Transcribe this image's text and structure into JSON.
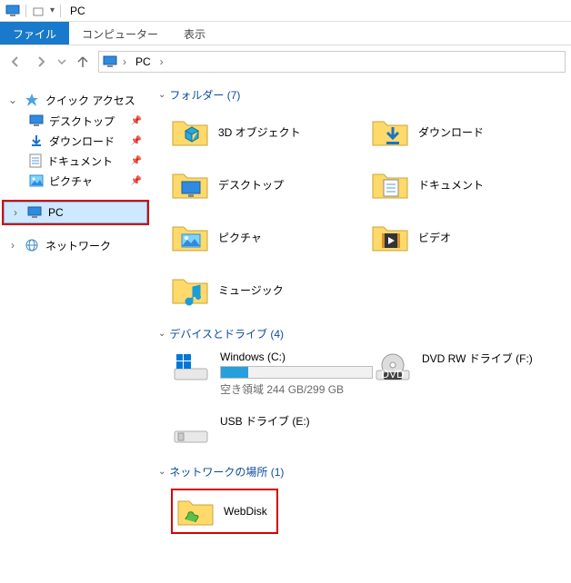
{
  "titlebar": {
    "title": "PC"
  },
  "ribbon": {
    "file": "ファイル",
    "computer": "コンピューター",
    "view": "表示"
  },
  "breadcrumb": {
    "root": "PC"
  },
  "sidebar": {
    "quick_access": "クイック アクセス",
    "items": [
      {
        "label": "デスクトップ"
      },
      {
        "label": "ダウンロード"
      },
      {
        "label": "ドキュメント"
      },
      {
        "label": "ピクチャ"
      }
    ],
    "pc": "PC",
    "network": "ネットワーク"
  },
  "sections": {
    "folders": {
      "title": "フォルダー (7)"
    },
    "devices": {
      "title": "デバイスとドライブ (4)"
    },
    "netloc": {
      "title": "ネットワークの場所 (1)"
    }
  },
  "folders": [
    {
      "label": "3D オブジェクト"
    },
    {
      "label": "ダウンロード"
    },
    {
      "label": "デスクトップ"
    },
    {
      "label": "ドキュメント"
    },
    {
      "label": "ピクチャ"
    },
    {
      "label": "ビデオ"
    },
    {
      "label": "ミュージック"
    }
  ],
  "drives": {
    "c": {
      "label": "Windows (C:)",
      "free": "空き領域 244 GB/299 GB",
      "fill_pct": 18
    },
    "dvd": {
      "label": "DVD RW ドライブ (F:)"
    },
    "usb": {
      "label": "USB ドライブ (E:)"
    }
  },
  "network_item": {
    "label": "WebDisk"
  }
}
